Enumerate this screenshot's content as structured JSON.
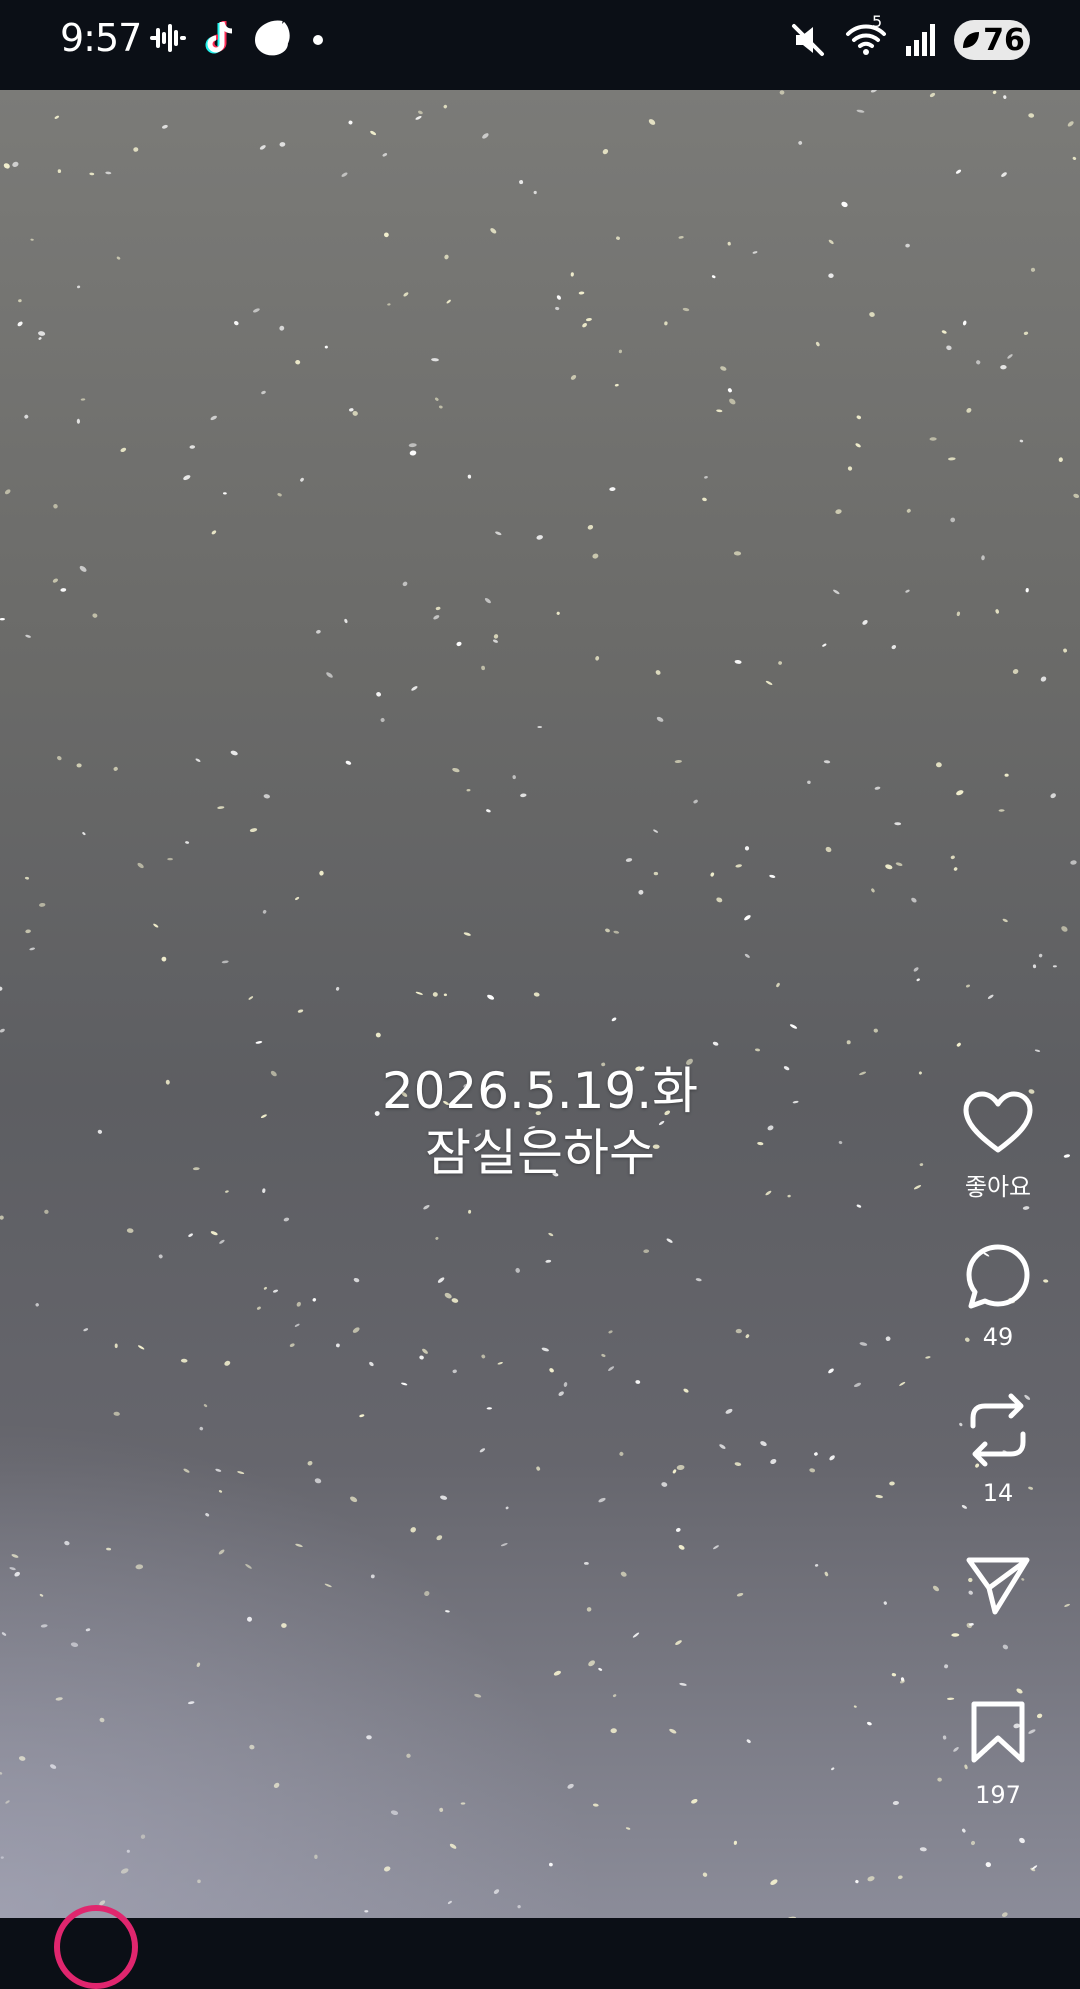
{
  "status_bar": {
    "time": "9:57",
    "left_icons": [
      "audio-wave-icon",
      "tiktok-icon",
      "threads-icon",
      "dot-icon"
    ],
    "right_icons": [
      "mute-icon",
      "wifi-icon",
      "signal-icon"
    ],
    "wifi_badge": "5",
    "battery": "76"
  },
  "video": {
    "caption_line1": "2026.5.19.화",
    "caption_line2": "잠실은하수"
  },
  "actions": {
    "like": {
      "icon": "heart-icon",
      "label": "좋아요"
    },
    "comment": {
      "icon": "comment-icon",
      "count": "49"
    },
    "repost": {
      "icon": "repost-icon",
      "count": "14"
    },
    "share": {
      "icon": "send-icon",
      "count": ""
    },
    "save": {
      "icon": "bookmark-icon",
      "count": "197"
    }
  },
  "colors": {
    "status_bg": "#0b0f16",
    "avatar_ring": "#e0266e"
  }
}
